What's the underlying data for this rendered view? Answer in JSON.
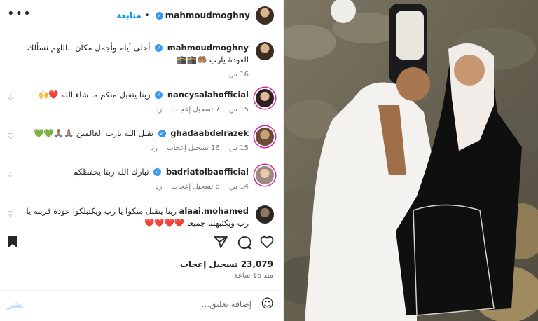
{
  "header": {
    "username": "mahmoudmoghny",
    "follow_label": "متابعة",
    "more_label": "•••"
  },
  "caption": {
    "username": "mahmoudmoghny",
    "text": "أحلى أيام وأجمل مكان ..اللهم نسألك العودة يارب 🤲🏽🕋🕋",
    "time": "16 س"
  },
  "comments": [
    {
      "username": "nancysalahofficial",
      "text": "ربنا يتقبل منكم ما شاء الله ❤️🙌",
      "time": "15 س",
      "likes": "7 تسجيل إعجاب",
      "reply": "رد"
    },
    {
      "username": "ghadaabdelrazek",
      "text": "تقبل الله يارب العالمين 🙏🏽🙏🏽💚💚",
      "time": "15 س",
      "likes": "16 تسجيل إعجاب",
      "reply": "رد"
    },
    {
      "username": "badriatolbaofficial",
      "text": "تبارك الله ربنا يحفظكم",
      "time": "14 س",
      "likes": "8 تسجيل إعجاب",
      "reply": "رد"
    },
    {
      "username": "alaai.mohamed",
      "text": "ربنا يتقبل منكوا يا رب ويكتبلكوا عودة قريبة يا رب ويكتبهلنا جميعا ❤️❤️❤️❤️",
      "time": "",
      "likes": "",
      "reply": ""
    }
  ],
  "footer": {
    "likes_count": "23,079 تسجيل إعجاب",
    "time_ago": "منذ 16 ساعة",
    "comment_placeholder": "إضافة تعليق...",
    "post_label": "نشر"
  },
  "icons": {
    "heart": "heart-icon",
    "comment": "comment-icon",
    "share": "share-icon",
    "save": "bookmark-icon",
    "emoji": "emoji-icon"
  },
  "colors": {
    "accent": "#0095f6",
    "verified": "#3897f0",
    "muted": "#737373"
  }
}
